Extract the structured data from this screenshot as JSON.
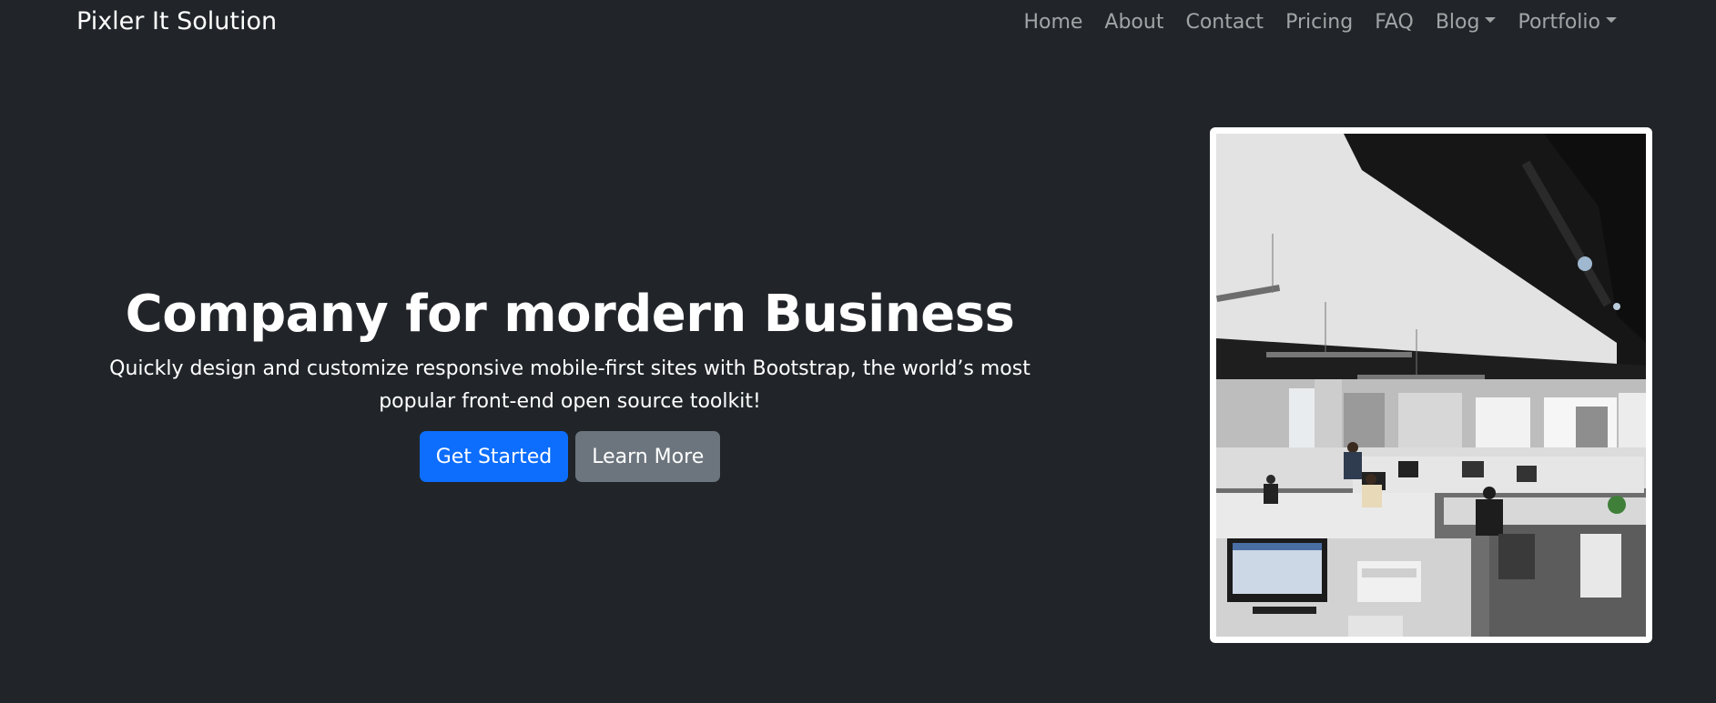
{
  "navbar": {
    "brand": "Pixler It Solution",
    "links": [
      "Home",
      "About",
      "Contact",
      "Pricing",
      "FAQ"
    ],
    "dropdowns": [
      "Blog",
      "Portfolio"
    ]
  },
  "hero": {
    "title": "Company for mordern Business",
    "subtitle": "Quickly design and customize responsive mobile-first sites with Bootstrap, the world’s most popular front-end open source toolkit!",
    "primary_button": "Get Started",
    "secondary_button": "Learn More"
  },
  "image": {
    "subject": "open-plan-office-photo"
  },
  "colors": {
    "background": "#212529",
    "primary": "#0d6efd",
    "secondary": "#6c757d",
    "nav_link": "rgba(255,255,255,0.58)"
  }
}
